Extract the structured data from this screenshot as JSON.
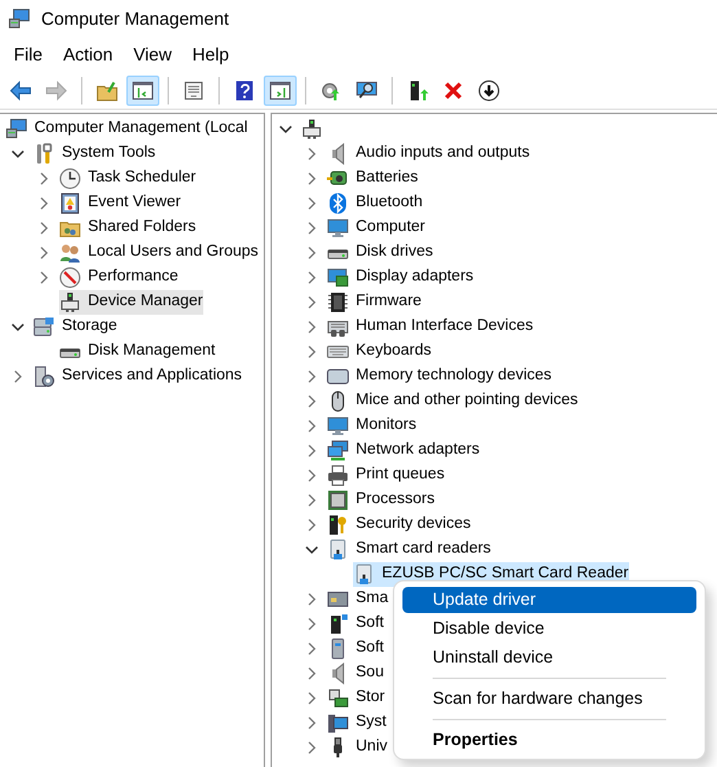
{
  "window": {
    "title": "Computer Management"
  },
  "menu_bar": [
    "File",
    "Action",
    "View",
    "Help"
  ],
  "toolbar": [
    {
      "pressed": false,
      "disabled": false
    },
    {
      "pressed": false,
      "disabled": true
    },
    {
      "pressed": false,
      "disabled": false
    },
    {
      "pressed": true,
      "disabled": false
    },
    {
      "pressed": false,
      "disabled": false
    },
    {
      "pressed": false,
      "disabled": false
    },
    {
      "pressed": true,
      "disabled": false
    },
    {
      "pressed": false,
      "disabled": false
    },
    {
      "pressed": false,
      "disabled": false
    },
    {
      "pressed": false,
      "disabled": false
    },
    {
      "pressed": false,
      "disabled": false
    },
    {
      "pressed": false,
      "disabled": false
    }
  ],
  "console_tree": [
    {
      "label": "Computer Management (Local",
      "selected": false,
      "children": [
        {
          "label": "System Tools",
          "expanded": true,
          "selected": false,
          "children": [
            {
              "label": "Task Scheduler",
              "expanded": false,
              "selected": false
            },
            {
              "label": "Event Viewer",
              "expanded": false,
              "selected": false
            },
            {
              "label": "Shared Folders",
              "expanded": false,
              "selected": false
            },
            {
              "label": "Local Users and Groups",
              "expanded": false,
              "selected": false
            },
            {
              "label": "Performance",
              "expanded": false,
              "selected": false
            },
            {
              "label": "Device Manager",
              "selected": true
            }
          ]
        },
        {
          "label": "Storage",
          "expanded": true,
          "selected": false,
          "children": [
            {
              "label": "Disk Management",
              "selected": false
            }
          ]
        },
        {
          "label": "Services and Applications",
          "expanded": false,
          "selected": false
        }
      ]
    }
  ],
  "device_tree": [
    {
      "expanded": true,
      "selected": false,
      "children": [
        {
          "label": "Audio inputs and outputs",
          "expanded": false,
          "selected": false
        },
        {
          "label": "Batteries",
          "expanded": false,
          "selected": false
        },
        {
          "label": "Bluetooth",
          "expanded": false,
          "selected": false
        },
        {
          "label": "Computer",
          "expanded": false,
          "selected": false
        },
        {
          "label": "Disk drives",
          "expanded": false,
          "selected": false
        },
        {
          "label": "Display adapters",
          "expanded": false,
          "selected": false
        },
        {
          "label": "Firmware",
          "expanded": false,
          "selected": false
        },
        {
          "label": "Human Interface Devices",
          "expanded": false,
          "selected": false
        },
        {
          "label": "Keyboards",
          "expanded": false,
          "selected": false
        },
        {
          "label": "Memory technology devices",
          "expanded": false,
          "selected": false
        },
        {
          "label": "Mice and other pointing devices",
          "expanded": false,
          "selected": false
        },
        {
          "label": "Monitors",
          "expanded": false,
          "selected": false
        },
        {
          "label": "Network adapters",
          "expanded": false,
          "selected": false
        },
        {
          "label": "Print queues",
          "expanded": false,
          "selected": false
        },
        {
          "label": "Processors",
          "expanded": false,
          "selected": false
        },
        {
          "label": "Security devices",
          "expanded": false,
          "selected": false
        },
        {
          "label": "Smart card readers",
          "expanded": true,
          "selected": false,
          "children": [
            {
              "label": "EZUSB PC/SC Smart Card Reader",
              "selected": true
            }
          ]
        },
        {
          "label": "Sma",
          "expanded": false,
          "selected": false
        },
        {
          "label": "Soft",
          "expanded": false,
          "selected": false
        },
        {
          "label": "Soft",
          "expanded": false,
          "selected": false
        },
        {
          "label": "Sou",
          "expanded": false,
          "selected": false
        },
        {
          "label": "Stor",
          "expanded": false,
          "selected": false
        },
        {
          "label": "Syst",
          "expanded": false,
          "selected": false
        },
        {
          "label": "Univ",
          "expanded": false,
          "selected": false
        }
      ]
    }
  ],
  "context_menu": [
    {
      "kind": "item",
      "label": "Update driver",
      "selected": true,
      "default": false
    },
    {
      "kind": "item",
      "label": "Disable device",
      "selected": false,
      "default": false
    },
    {
      "kind": "item",
      "label": "Uninstall device",
      "selected": false,
      "default": false
    },
    {
      "kind": "separator"
    },
    {
      "kind": "item",
      "label": "Scan for hardware changes",
      "selected": false,
      "default": false
    },
    {
      "kind": "separator"
    },
    {
      "kind": "item",
      "label": "Properties",
      "selected": false,
      "default": true
    }
  ]
}
